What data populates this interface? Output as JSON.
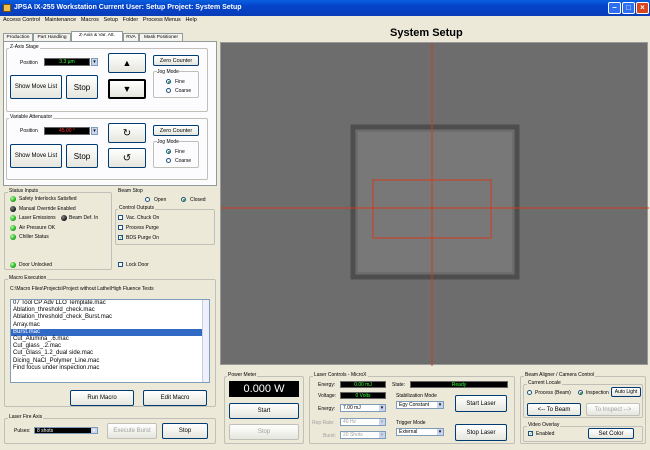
{
  "window": {
    "title": "JPSA IX-255 Workstation   Current User:  Setup               Project:  System Setup"
  },
  "menu": [
    "Access Control",
    "Maintenance",
    "Macros",
    "Setup",
    "Folder",
    "Process Menus",
    "Help"
  ],
  "tabs": [
    "Production",
    "Part Handling",
    "Z-Axis & Var. Att.",
    "RVA",
    "Mask Positioner"
  ],
  "page_title": "System Setup",
  "z_axis": {
    "group_label": "Z-Axis Stage",
    "position_label": "Position",
    "position_value": "3.3 µm",
    "zero_counter": "Zero Counter",
    "show_move_list": "Show Move List",
    "stop": "Stop",
    "jog_mode": "Jog Mode",
    "fine": "Fine",
    "coarse": "Coarse"
  },
  "attenuator": {
    "group_label": "Variable Attenuator",
    "position_label": "Position",
    "position_value": "45.00 °",
    "zero_counter": "Zero Counter",
    "show_move_list": "Show Move List",
    "stop": "Stop",
    "jog_mode": "Jog Mode",
    "fine": "Fine",
    "coarse": "Coarse"
  },
  "status": {
    "group_label": "Status Inputs",
    "items": [
      "Safety Interlocks Satisfied",
      "Manual Override Enabled",
      "Laser Emissions",
      "Air Pressure OK",
      "Chiller Status"
    ],
    "beam_def": "Beam Def. In",
    "door": "Door Unlocked"
  },
  "beam_stop": {
    "label": "Beam Stop",
    "open": "Open",
    "closed": "Closed"
  },
  "control_outputs": {
    "label": "Control Outputs",
    "items": [
      "Vac. Chuck On",
      "Process Purge",
      "BDS Purge On"
    ],
    "lock_door": "Lock Door"
  },
  "macro": {
    "group_label": "Macro Execution",
    "path": "C:\\Macro Files\\Projects\\Project without Lathe\\High Fluence Tests",
    "items": [
      "07 Tool CP Adv  LLO  Template.mac",
      "Ablation_threshold_check.mac",
      "Ablation_threshold_check_Burst.mac",
      "Array.mac",
      "Burst.mac",
      "Cut_Alumina_.6.mac",
      "Cut_glass_.2.mac",
      "Cut_Glass_1.2_dual side.mac",
      "Dicing_NaCl_Polymer_Line.mac",
      "Find focus under inspection.mac"
    ],
    "selected": 4,
    "run": "Run Macro",
    "edit": "Edit Macro"
  },
  "fire_axis": {
    "group_label": "Laser Fire Axis",
    "pulses_label": "Pulses:",
    "pulses_value": "8 shots",
    "execute_burst": "Execute Burst",
    "stop": "Stop"
  },
  "power_meter": {
    "label": "Power Meter",
    "value": "0.000 W",
    "start": "Start",
    "stop": "Stop"
  },
  "laser": {
    "label": "Laser Controls - MicroX",
    "energy_label": "Energy:",
    "energy_value": "0.00 mJ",
    "voltage_label": "Voltage:",
    "voltage_value": "0 Volts",
    "state_label": "State:",
    "state_value": "Ready",
    "energy_set_label": "Energy:",
    "energy_set": "7.00 mJ",
    "rep_label": "Rep Rate:",
    "rep_value": "40 Hz",
    "burst_label": "Burst:",
    "burst_value": "20 Shots",
    "stab_label": "Stabilization Mode",
    "stab_value": "Egy Constant",
    "trig_label": "Trigger Mode",
    "trig_value": "External",
    "start": "Start Laser",
    "stop": "Stop Laser"
  },
  "aligner": {
    "label": "Beam Aligner / Camera Control",
    "locale_label": "Current Locale",
    "process": "Process (Beam)",
    "inspection": "Inspection",
    "auto_light": "Auto Light",
    "to_beam": "<-- To Beam",
    "to_inspect": "To Inspect -->",
    "overlay_label": "Video Overlay",
    "enabled": "Enabled",
    "set_color": "Set Color"
  }
}
